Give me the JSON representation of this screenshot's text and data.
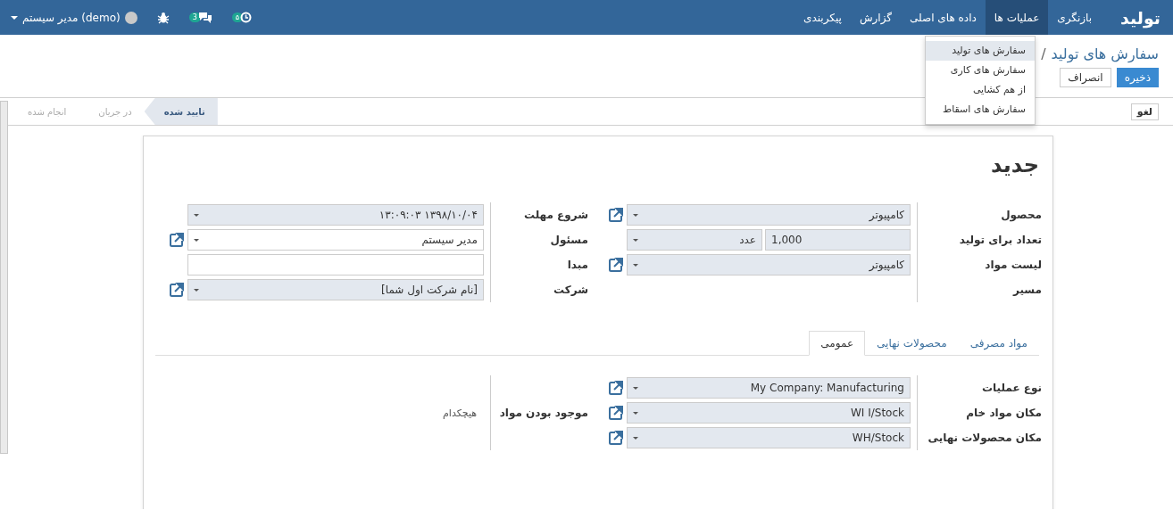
{
  "navbar": {
    "brand": "تولید",
    "menu": [
      {
        "label": "بازنگری",
        "selected": false
      },
      {
        "label": "عملیات ها",
        "selected": true
      },
      {
        "label": "داده های اصلی",
        "selected": false
      },
      {
        "label": "گزارش",
        "selected": false
      },
      {
        "label": "پیکربندی",
        "selected": false
      }
    ],
    "activity_badge": "۵",
    "message_badge": "3",
    "user": "مدیر سیستم (demo)"
  },
  "menu_dropdown": [
    {
      "label": "سفارش های تولید",
      "selected": true
    },
    {
      "label": "سفارش های کاری",
      "selected": false
    },
    {
      "label": "از هم کشایی",
      "selected": false
    },
    {
      "label": "سفارش های اسقاط",
      "selected": false
    }
  ],
  "breadcrumb": {
    "link": "سفارش های تولید",
    "separator": "/"
  },
  "buttons": [
    {
      "label": "ذخیره",
      "kind": "primary"
    },
    {
      "label": "انصراف",
      "kind": "secondary"
    }
  ],
  "header_buttons": [
    "لغو"
  ],
  "stages": [
    {
      "label": "تایید شده",
      "selected": true
    },
    {
      "label": "در جریان",
      "selected": false
    },
    {
      "label": "انجام شده",
      "selected": false
    }
  ],
  "form": {
    "title": "جدید",
    "groups": [
      {
        "fields": [
          {
            "label": "محصول",
            "kind": "many2one",
            "value": "کامپیوتر",
            "required": true
          },
          {
            "label": "تعداد برای تولید",
            "kind": "quantity",
            "value": "1,000",
            "unit": "عدد",
            "required": true
          },
          {
            "label": "لیست مواد",
            "kind": "many2one",
            "value": "کامپیوتر",
            "required": true
          },
          {
            "label": "مسیر",
            "kind": "none"
          }
        ]
      },
      {
        "fields": [
          {
            "label": "شروع مهلت",
            "kind": "select",
            "value": "۱۳۹۸/۱۰/۰۴ ۱۳:۰۹:۰۳",
            "required": true
          },
          {
            "label": "مسئول",
            "kind": "many2one",
            "value": "مدیر سیستم",
            "required": false
          },
          {
            "label": "مبدا",
            "kind": "text",
            "required": false
          },
          {
            "label": "شرکت",
            "kind": "many2one",
            "value": "[نام شرکت اول شما]",
            "required": true
          }
        ]
      }
    ],
    "tabs": [
      {
        "label": "مواد مصرفی",
        "selected": false
      },
      {
        "label": "محصولات نهایی",
        "selected": false
      },
      {
        "label": "عمومی",
        "selected": true
      }
    ],
    "tab_groups": [
      {
        "fields": [
          {
            "label": "نوع عملیات",
            "kind": "many2one",
            "value": "My Company: Manufacturing",
            "required": true
          },
          {
            "label": "مکان مواد خام",
            "kind": "many2one",
            "value": "WI I/Stock",
            "required": true
          },
          {
            "label": "مکان محصولات نهایی",
            "kind": "many2one",
            "value": "WH/Stock",
            "required": true
          }
        ]
      },
      {
        "fields": [
          {
            "label": "موجود بودن مواد",
            "kind": "readonly",
            "value": "هیچکدام"
          }
        ]
      }
    ]
  }
}
